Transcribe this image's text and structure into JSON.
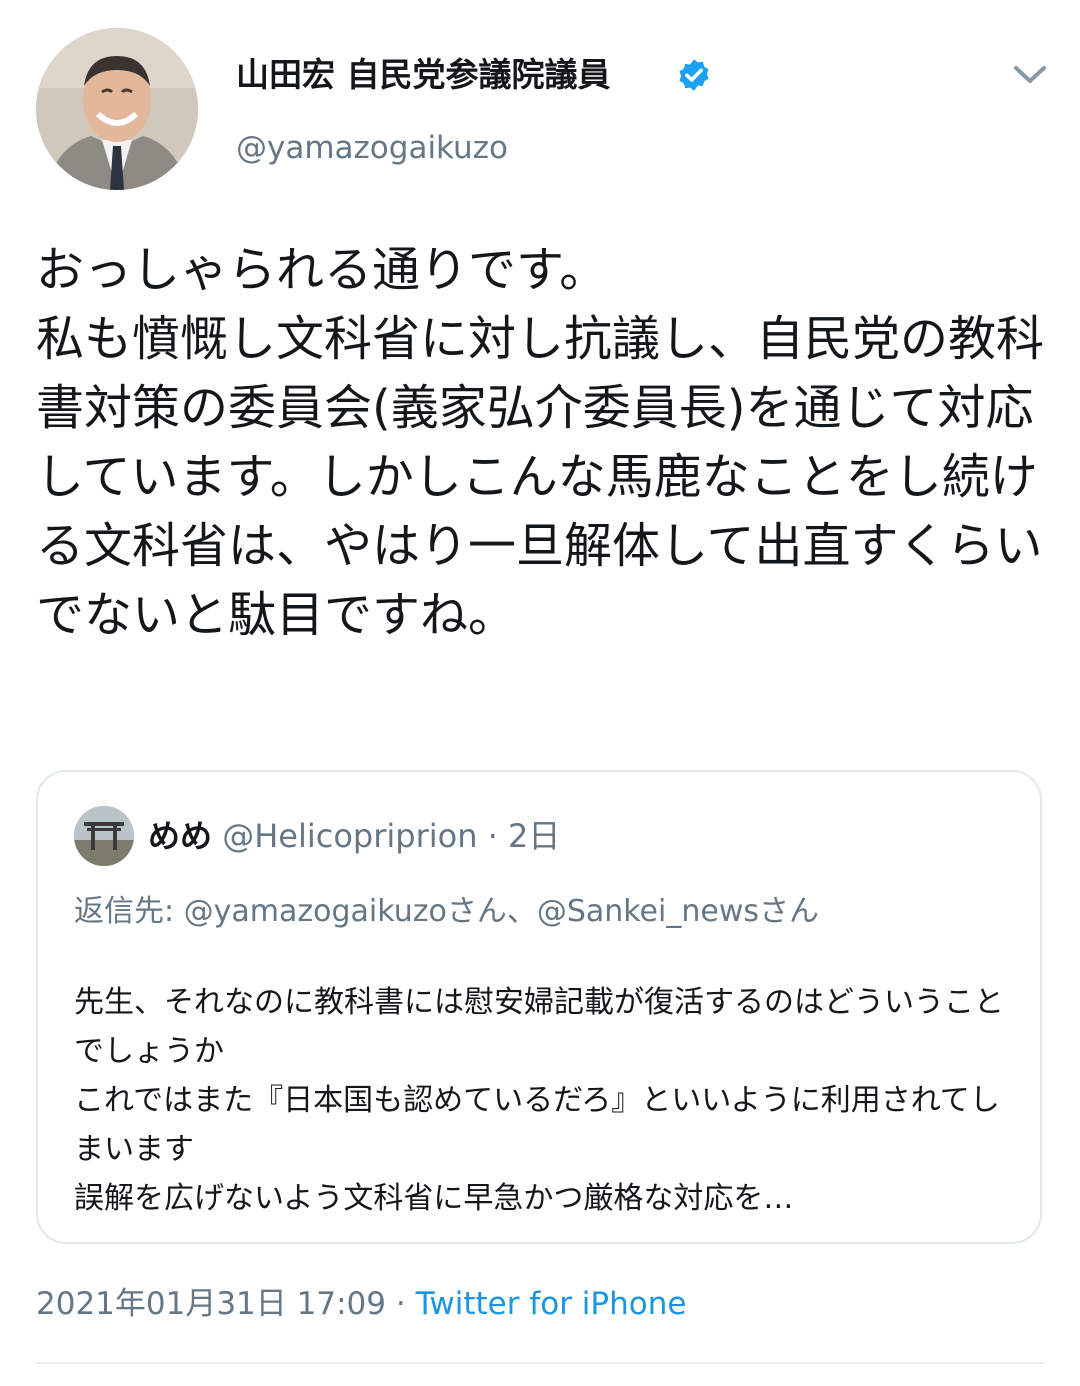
{
  "author": {
    "display_name": "山田宏 自民党参議院議員",
    "handle": "@yamazogaikuzo",
    "verified_icon": "verified-badge-icon",
    "avatar_icon": "profile-photo"
  },
  "menu_icon": "chevron-down-icon",
  "tweet": {
    "text": "おっしゃられる通りです。\n私も憤慨し文科省に対し抗議し、自民党の教科書対策の委員会(義家弘介委員長)を通じて対応しています。しかしこんな馬鹿なことをし続ける文科省は、やはり一旦解体して出直すくらいでないと駄目ですね。"
  },
  "quoted_tweet": {
    "display_name": "めめ",
    "handle": "@Helicopriprion",
    "separator": "·",
    "time": "2日",
    "reply_to": "返信先: @yamazogaikuzoさん、@Sankei_newsさん",
    "text": "先生、それなのに教科書には慰安婦記載が復活するのはどういうことでしょうか\nこれではまた『日本国も認めているだろ』といいように利用されてしまいます\n誤解を広げないよう文科省に早急かつ厳格な対応を…"
  },
  "meta": {
    "timestamp": "2021年01月31日 17:09",
    "separator": "·",
    "source": "Twitter for iPhone"
  },
  "colors": {
    "text": "#14171a",
    "secondary": "#657786",
    "link": "#1b95e0",
    "verified": "#1da1f2",
    "border": "#e1e8ed"
  }
}
